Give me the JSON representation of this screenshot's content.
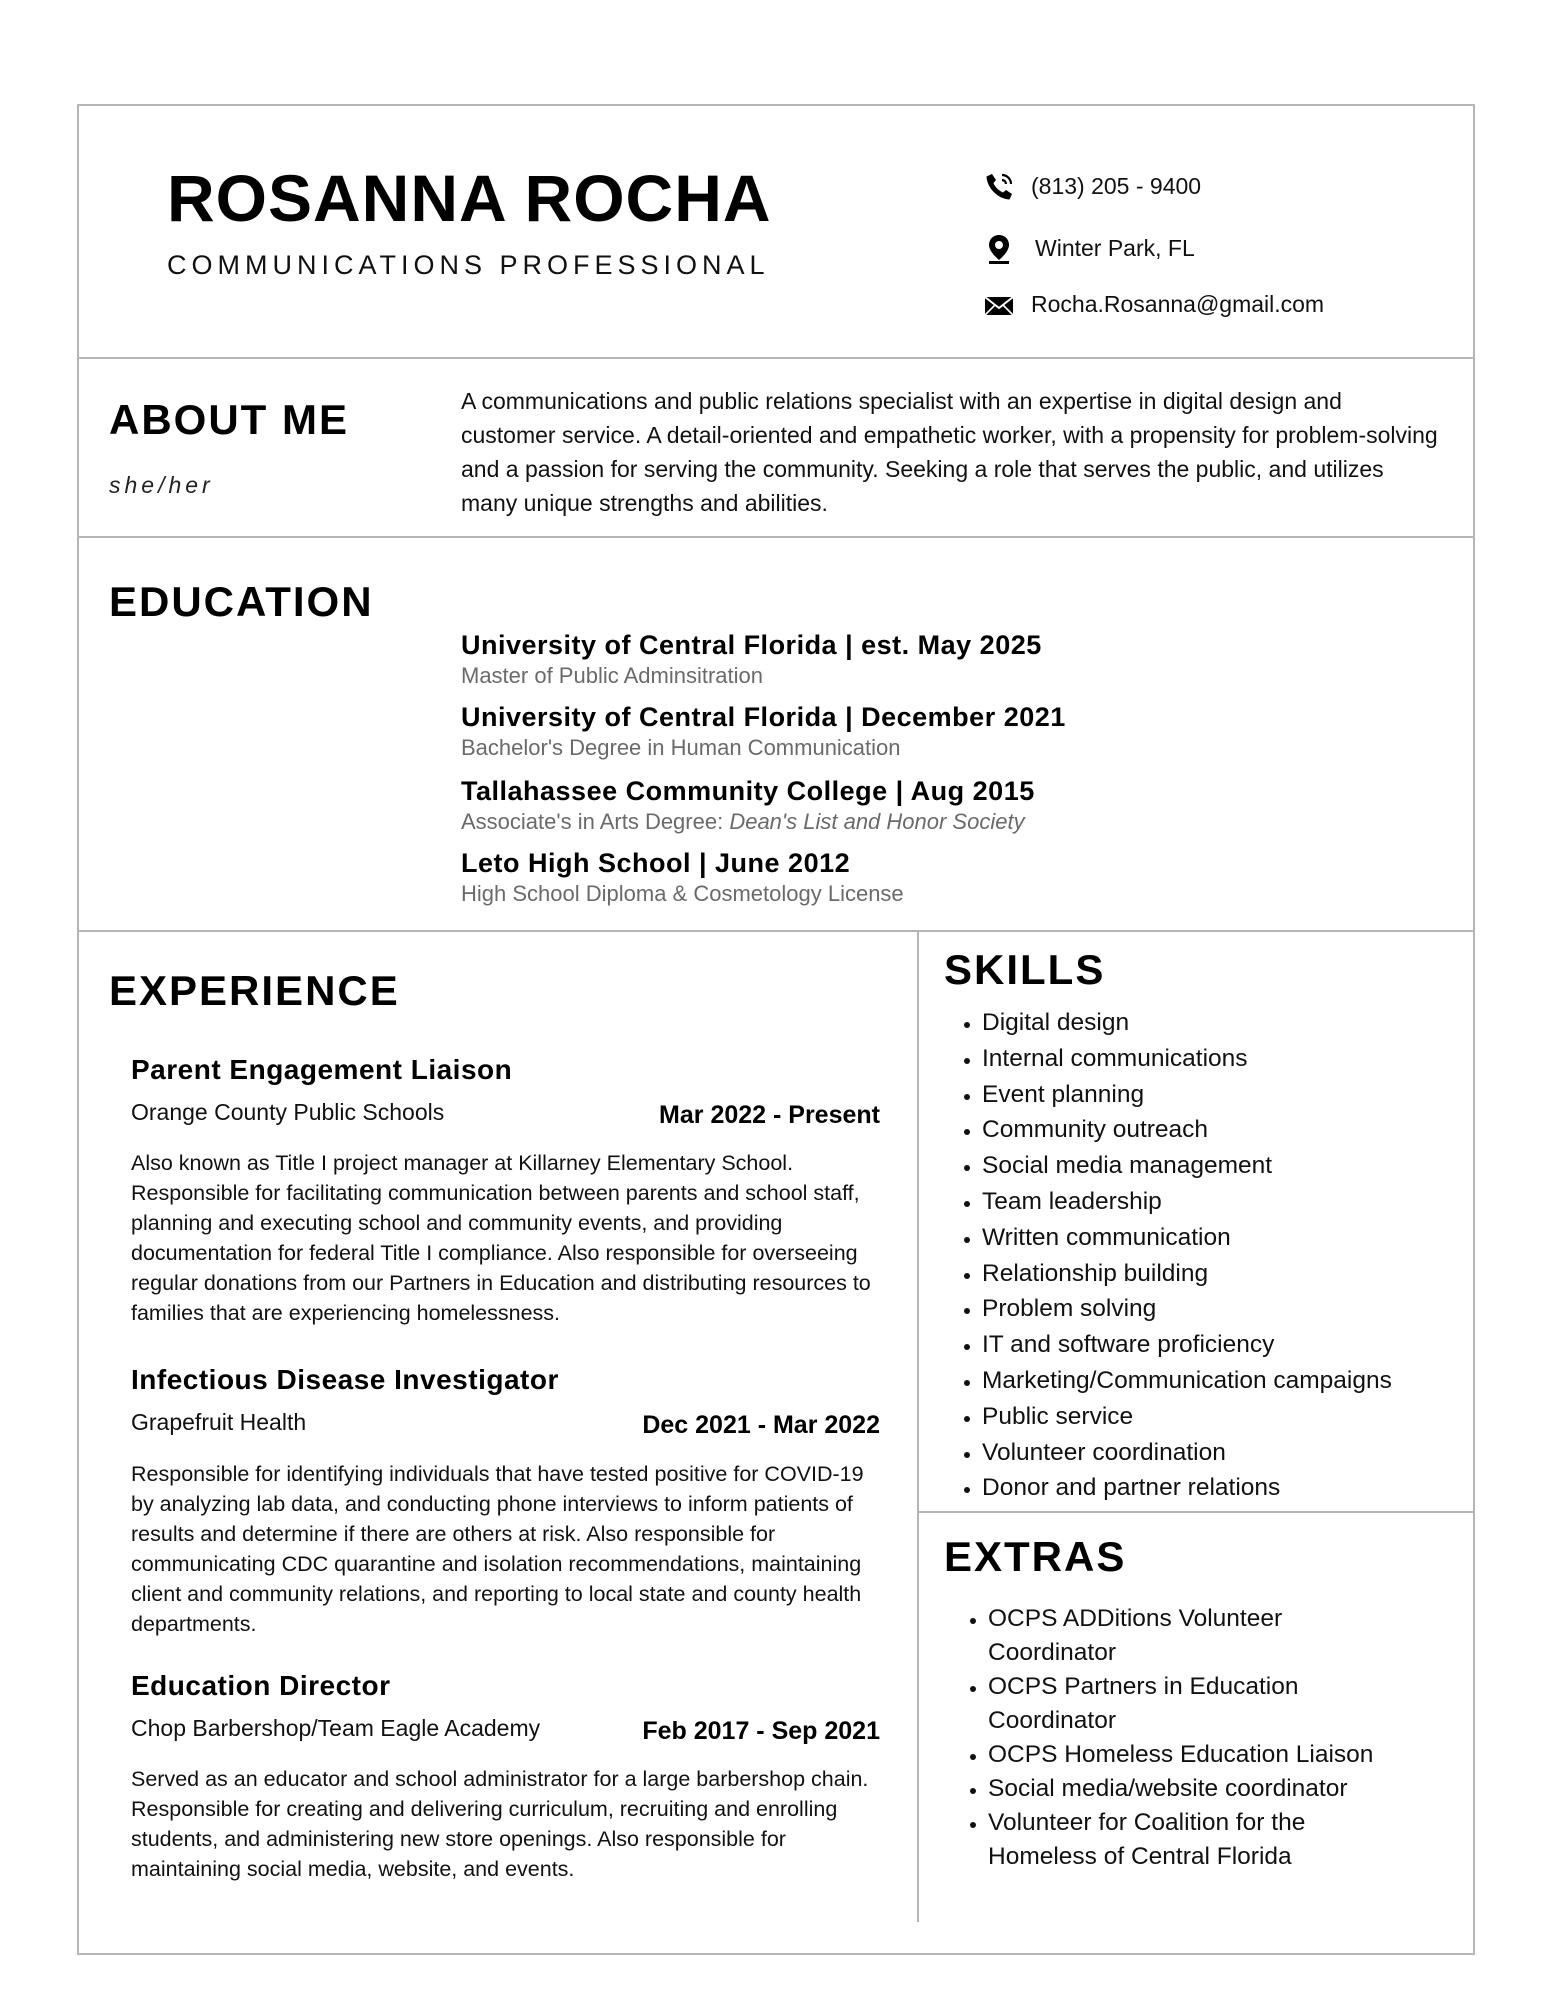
{
  "header": {
    "name": "ROSANNA ROCHA",
    "title": "COMMUNICATIONS PROFESSIONAL",
    "contact": {
      "phone": "(813) 205 - 9400",
      "location": "Winter Park, FL",
      "email": "Rocha.Rosanna@gmail.com"
    },
    "icons": [
      "phone-icon",
      "location-pin-icon",
      "envelope-icon"
    ]
  },
  "about": {
    "heading": "ABOUT ME",
    "pronouns": "she/her",
    "text": "A communications and public relations specialist with an expertise in digital design and customer service. A detail-oriented and empathetic worker, with a propensity for problem-solving and a passion for serving the community. Seeking a role that serves the public, and utilizes many unique strengths and abilities."
  },
  "education": {
    "heading": "EDUCATION",
    "items": [
      {
        "school": "University of Central Florida | est. May 2025",
        "detail": "Master of Public Adminsitration",
        "detail_italic": ""
      },
      {
        "school": "University of Central Florida | December 2021",
        "detail": "Bachelor's Degree in Human Communication",
        "detail_italic": ""
      },
      {
        "school": "Tallahassee Community College | Aug 2015",
        "detail": "Associate's in Arts Degree: ",
        "detail_italic": "Dean's List and Honor Society"
      },
      {
        "school": "Leto High School | June 2012",
        "detail": "High School Diploma & Cosmetology License",
        "detail_italic": ""
      }
    ]
  },
  "experience": {
    "heading": "EXPERIENCE",
    "jobs": [
      {
        "title": "Parent Engagement Liaison",
        "org": "Orange County Public Schools",
        "dates": "Mar 2022 - Present",
        "description": "Also known as Title I project manager at Killarney Elementary School. Responsible for facilitating communication between parents and school staff, planning and executing school and community events, and providing documentation for federal Title I compliance. Also responsible for overseeing regular donations from our Partners in Education and distributing resources to families that are experiencing homelessness."
      },
      {
        "title": "Infectious Disease Investigator",
        "org": "Grapefruit Health",
        "dates": "Dec 2021 - Mar 2022",
        "description": "Responsible for identifying individuals that have tested positive for COVID-19 by analyzing lab data, and conducting phone interviews to inform patients of results and determine if there are others at risk. Also responsible for communicating CDC quarantine and isolation recommendations, maintaining client and community relations, and reporting to local state and county health departments."
      },
      {
        "title": "Education Director",
        "org": "Chop Barbershop/Team Eagle Academy",
        "dates": "Feb 2017 - Sep 2021",
        "description": "Served as an educator and school administrator for a large barbershop chain. Responsible for creating and delivering curriculum, recruiting and enrolling students, and administering new store openings. Also responsible for maintaining social media, website, and events."
      }
    ]
  },
  "skills": {
    "heading": "SKILLS",
    "items": [
      "Digital design",
      "Internal communications",
      "Event planning",
      "Community outreach",
      "Social media management",
      "Team leadership",
      "Written communication",
      "Relationship building",
      "Problem solving",
      "IT and software proficiency",
      "Marketing/Communication campaigns",
      "Public service",
      "Volunteer coordination",
      "Donor and partner relations"
    ]
  },
  "extras": {
    "heading": "EXTRAS",
    "items": [
      "OCPS ADDitions Volunteer Coordinator",
      "OCPS Partners in Education Coordinator",
      "OCPS Homeless Education Liaison",
      "Social media/website coordinator",
      "Volunteer for Coalition for the Homeless of Central Florida"
    ]
  }
}
